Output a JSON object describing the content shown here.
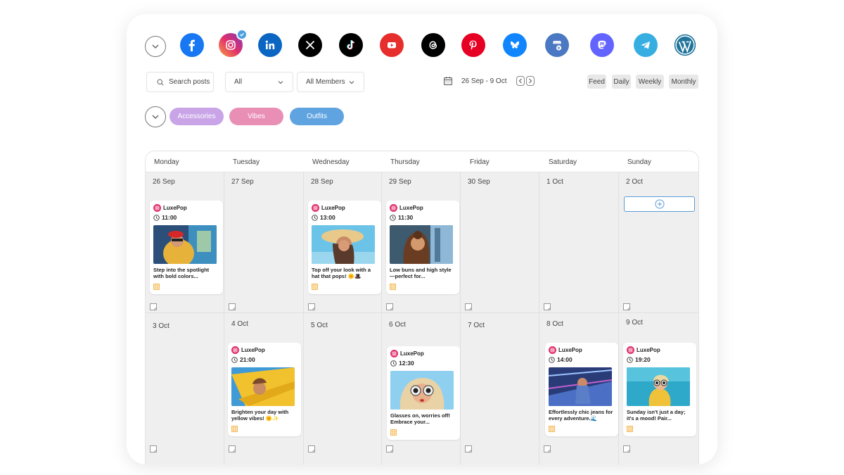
{
  "networks": [
    {
      "name": "facebook-icon",
      "color": "#1877f2"
    },
    {
      "name": "instagram-icon",
      "color": "#d6249f",
      "selected": true
    },
    {
      "name": "linkedin-icon",
      "color": "#0a66c2"
    },
    {
      "name": "x-icon",
      "color": "#000000"
    },
    {
      "name": "tiktok-icon",
      "color": "#000000"
    },
    {
      "name": "youtube-icon",
      "color": "#e62e2d"
    },
    {
      "name": "threads-icon",
      "color": "#000000"
    },
    {
      "name": "pinterest-icon",
      "color": "#e60023"
    },
    {
      "name": "bluesky-icon",
      "color": "#1185fe"
    },
    {
      "name": "google-business-icon",
      "color": "#4a78c2"
    },
    {
      "name": "mastodon-icon",
      "color": "#6364ff"
    },
    {
      "name": "telegram-icon",
      "color": "#37aee2"
    },
    {
      "name": "wordpress-icon",
      "color": "#21759b"
    }
  ],
  "toolbar": {
    "search_placeholder": "Search posts",
    "filter_value": "All",
    "members_value": "All Members",
    "date_range": "26 Sep - 9 Oct",
    "views": [
      "Feed",
      "Daily",
      "Weekly",
      "Monthly"
    ]
  },
  "tags": [
    {
      "label": "Accessories",
      "color": "#c9a5e8"
    },
    {
      "label": "Vibes",
      "color": "#e98fb6"
    },
    {
      "label": "Outfits",
      "color": "#5fa3e0"
    }
  ],
  "calendar": {
    "days": [
      "Monday",
      "Tuesday",
      "Wednesday",
      "Thursday",
      "Friday",
      "Saturday",
      "Sunday"
    ],
    "week1": [
      "26 Sep",
      "27 Sep",
      "28 Sep",
      "29 Sep",
      "30 Sep",
      "1 Oct",
      "2 Oct"
    ],
    "week2": [
      "3 Oct",
      "4 Oct",
      "5 Oct",
      "6 Oct",
      "7 Oct",
      "8 Oct",
      "9 Oct"
    ]
  },
  "posts": [
    {
      "account": "LuxePop",
      "time": "11:00",
      "caption": "Step into the spotlight with bold colors..."
    },
    {
      "account": "LuxePop",
      "time": "13:00",
      "caption": "Top off your look with a hat that pops! 🌞🎩"
    },
    {
      "account": "LuxePop",
      "time": "11:30",
      "caption": "Low buns and high style—perfect for..."
    },
    {
      "account": "LuxePop",
      "time": "21:00",
      "caption": "Brighten your day with yellow vibes! 🌞✨"
    },
    {
      "account": "LuxePop",
      "time": "12:30",
      "caption": "Glasses on, worries off! Embrace your..."
    },
    {
      "account": "LuxePop",
      "time": "14:00",
      "caption": "Effortlessly chic jeans for every adventure.🌊"
    },
    {
      "account": "LuxePop",
      "time": "19:20",
      "caption": "Sunday isn't just a day; it's a mood! Pair..."
    }
  ]
}
